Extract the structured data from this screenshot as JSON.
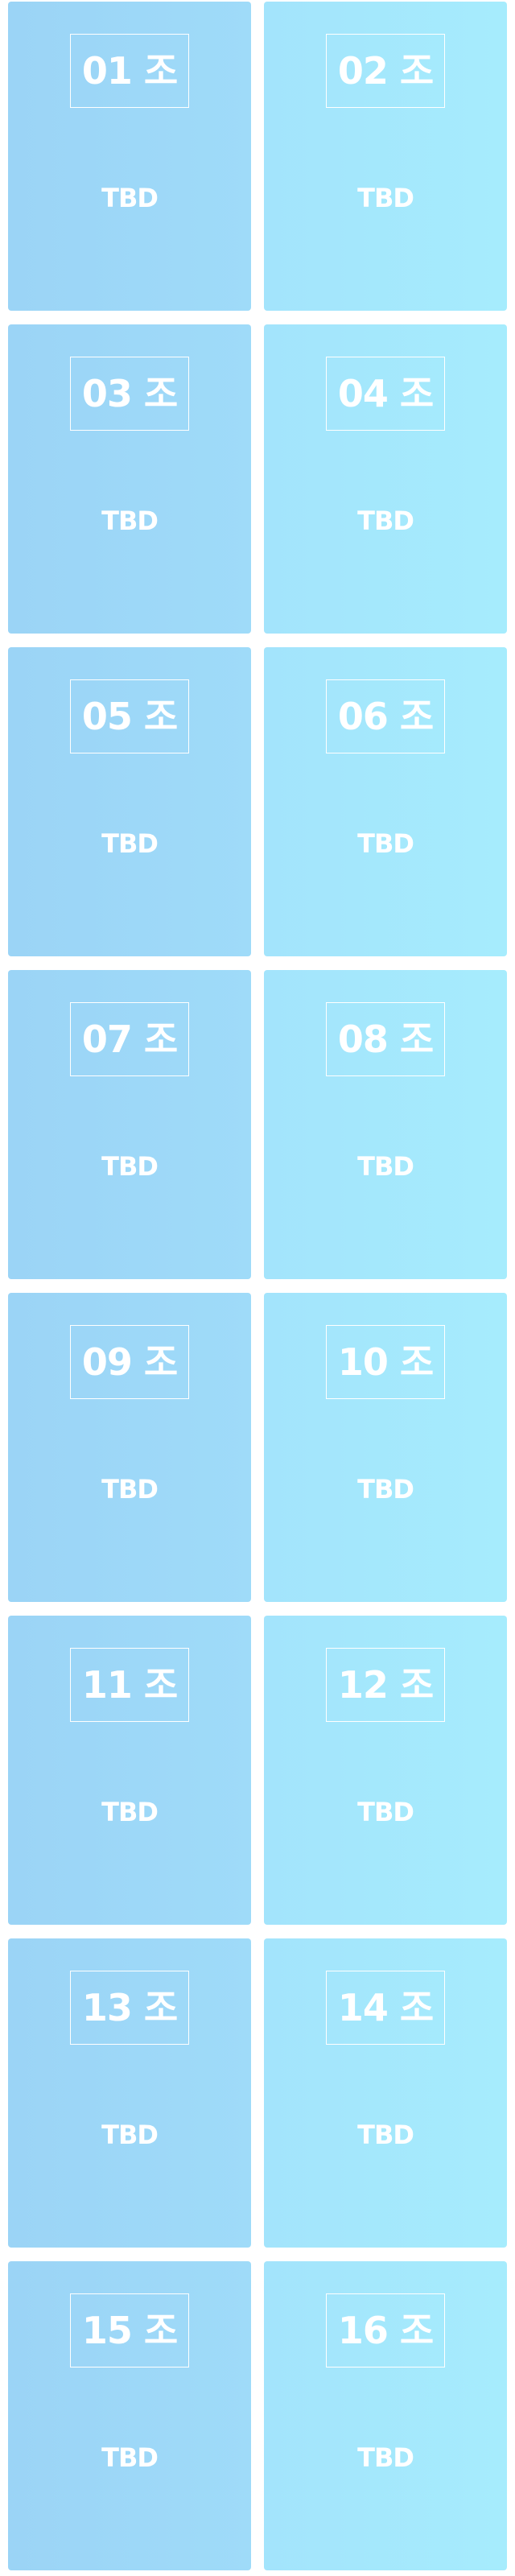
{
  "groups": [
    {
      "label": "01 조",
      "status": "TBD"
    },
    {
      "label": "02 조",
      "status": "TBD"
    },
    {
      "label": "03 조",
      "status": "TBD"
    },
    {
      "label": "04 조",
      "status": "TBD"
    },
    {
      "label": "05 조",
      "status": "TBD"
    },
    {
      "label": "06 조",
      "status": "TBD"
    },
    {
      "label": "07 조",
      "status": "TBD"
    },
    {
      "label": "08 조",
      "status": "TBD"
    },
    {
      "label": "09 조",
      "status": "TBD"
    },
    {
      "label": "10 조",
      "status": "TBD"
    },
    {
      "label": "11 조",
      "status": "TBD"
    },
    {
      "label": "12 조",
      "status": "TBD"
    },
    {
      "label": "13 조",
      "status": "TBD"
    },
    {
      "label": "14 조",
      "status": "TBD"
    },
    {
      "label": "15 조",
      "status": "TBD"
    },
    {
      "label": "16 조",
      "status": "TBD"
    }
  ],
  "colors": {
    "left_card": "#9bd4f6",
    "right_card": "#a6ecfd",
    "text": "#ffffff"
  }
}
